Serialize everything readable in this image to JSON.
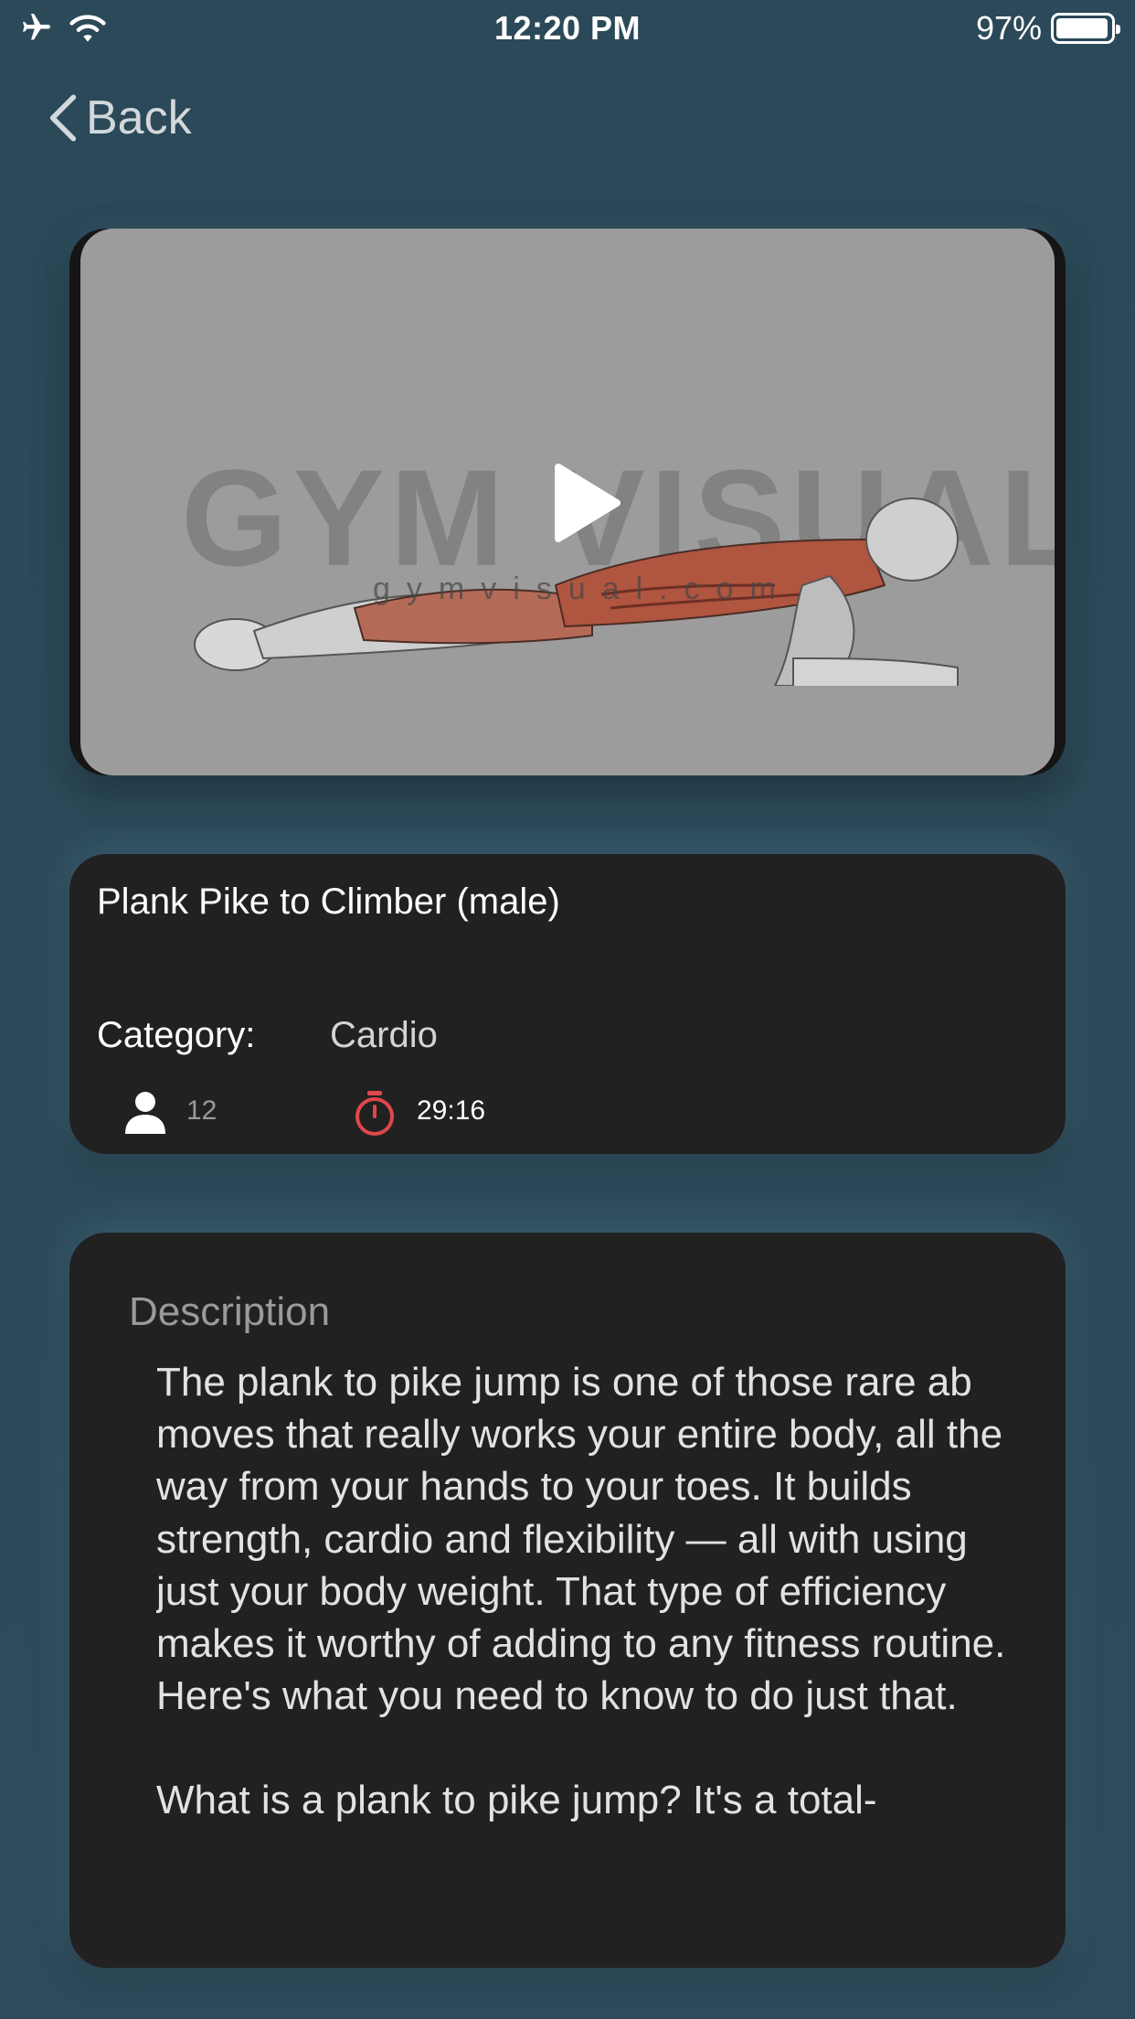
{
  "status_bar": {
    "time": "12:20 PM",
    "battery_percent_label": "97%",
    "battery_level": 0.97,
    "icons": [
      "airplane-icon",
      "wifi-icon",
      "battery-icon"
    ]
  },
  "nav": {
    "back_label": "Back"
  },
  "video": {
    "watermark": "GYM VISUAL",
    "watermark_sub": "gymvisual.com"
  },
  "exercise": {
    "title": "Plank Pike to Climber (male)",
    "category_label": "Category:",
    "category_value": "Cardio",
    "participants": "12",
    "duration": "29:16"
  },
  "description": {
    "heading": "Description",
    "paragraphs": [
      "The plank to pike jump is one of those rare ab moves that really works your entire body, all the way from your hands to your toes. It builds strength, cardio and flexibility — all with using just your body weight. That type of efficiency makes it worthy of adding to any fitness routine. Here's what you need to know to do just that.",
      "What is a plank to pike jump? It's a total-"
    ]
  },
  "colors": {
    "background": "#2c4a5a",
    "card": "#212121",
    "timer_accent": "#e0474c"
  }
}
